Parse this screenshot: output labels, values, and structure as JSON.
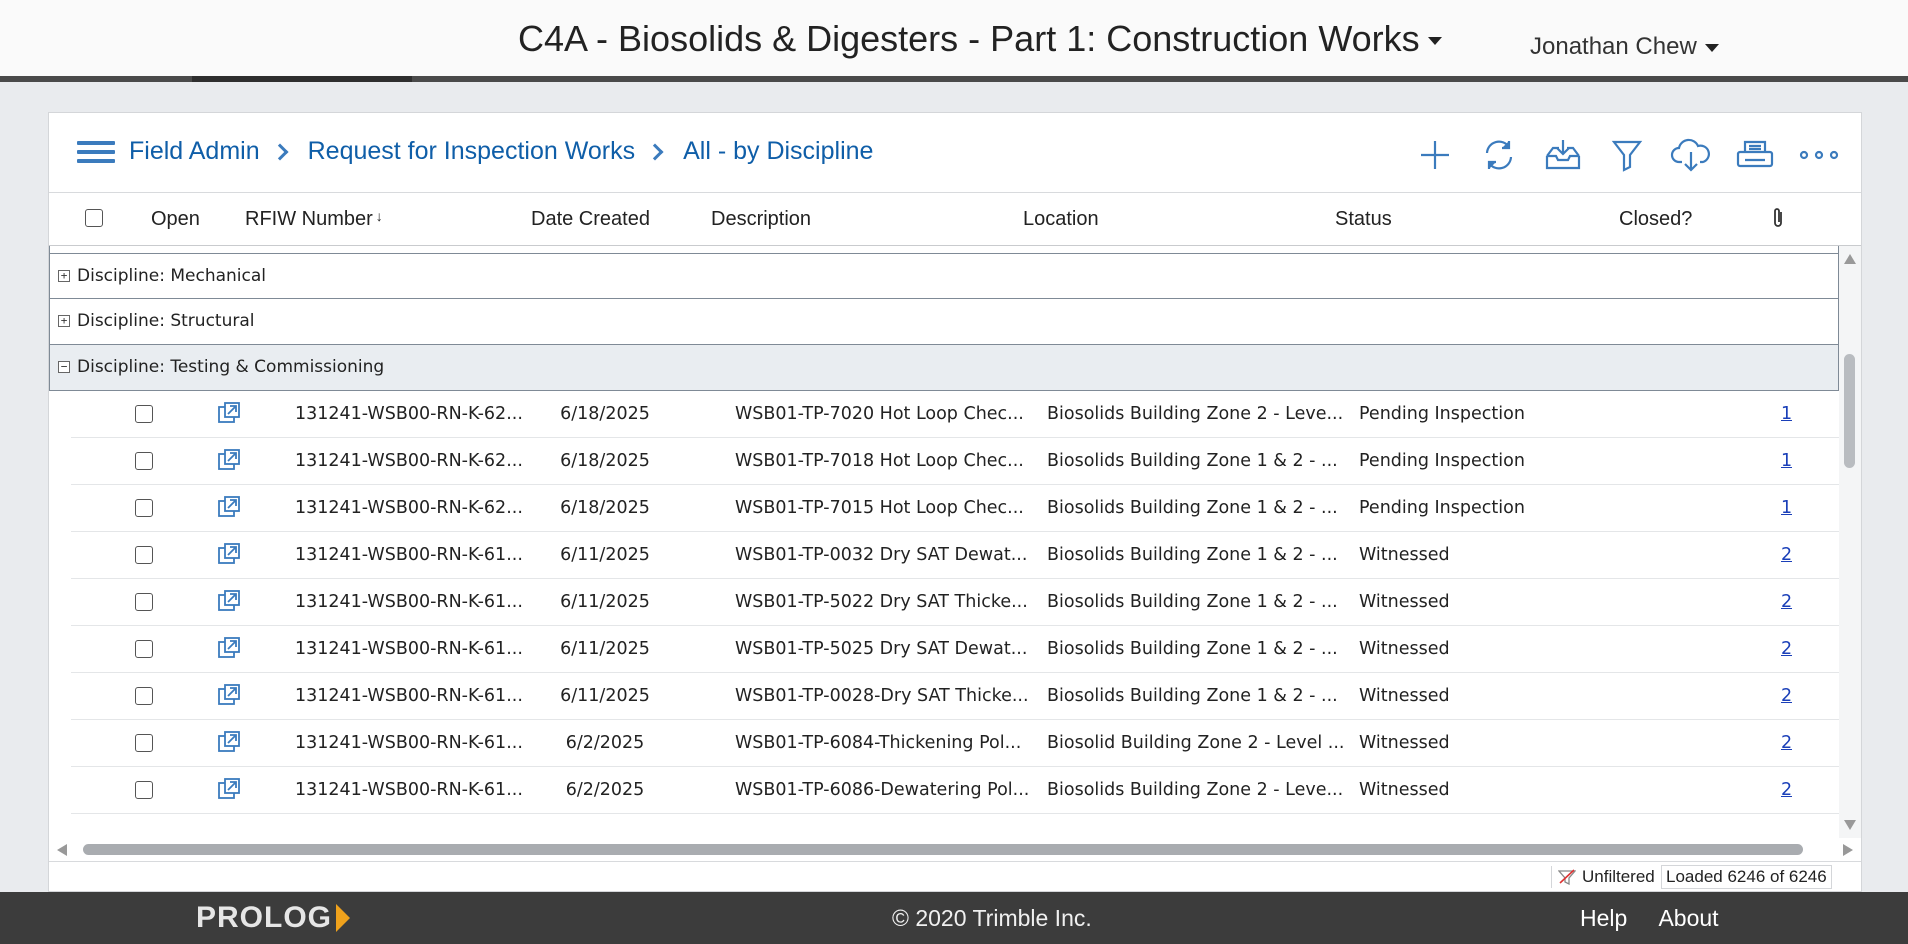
{
  "header": {
    "project_title": "C4A - Biosolids & Digesters - Part 1: Construction Works",
    "user_name": "Jonathan Chew"
  },
  "breadcrumb": [
    "Field Admin",
    "Request for Inspection Works",
    "All - by Discipline"
  ],
  "toolbar": {
    "icons": [
      "add-icon",
      "refresh-icon",
      "inbox-download-icon",
      "filter-icon",
      "cloud-download-icon",
      "print-icon",
      "more-icon"
    ]
  },
  "columns": {
    "open": "Open",
    "number": "RFIW Number",
    "sort_indicator": "↓",
    "date": "Date Created",
    "description": "Description",
    "location": "Location",
    "status": "Status",
    "closed": "Closed?"
  },
  "groups": {
    "mechanical": "Discipline: Mechanical",
    "structural": "Discipline: Structural",
    "testing": "Discipline: Testing & Commissioning"
  },
  "rows": [
    {
      "number": "131241-WSB00-RN-K-62...",
      "date": "6/18/2025",
      "description": "WSB01-TP-7020 Hot Loop Chec...",
      "location": "Biosolids Building Zone 2 - Leve...",
      "status": "Pending Inspection",
      "attachments": "1"
    },
    {
      "number": "131241-WSB00-RN-K-62...",
      "date": "6/18/2025",
      "description": "WSB01-TP-7018 Hot Loop Chec...",
      "location": "Biosolids Building Zone 1 & 2 - ...",
      "status": "Pending Inspection",
      "attachments": "1"
    },
    {
      "number": "131241-WSB00-RN-K-62...",
      "date": "6/18/2025",
      "description": "WSB01-TP-7015 Hot Loop Chec...",
      "location": "Biosolids Building Zone 1 & 2 - ...",
      "status": "Pending Inspection",
      "attachments": "1"
    },
    {
      "number": "131241-WSB00-RN-K-61...",
      "date": "6/11/2025",
      "description": "WSB01-TP-0032 Dry SAT Dewat...",
      "location": "Biosolids Building Zone 1 & 2 - ...",
      "status": "Witnessed",
      "attachments": "2"
    },
    {
      "number": "131241-WSB00-RN-K-61...",
      "date": "6/11/2025",
      "description": "WSB01-TP-5022 Dry SAT Thicke...",
      "location": "Biosolids Building Zone 1 & 2 - ...",
      "status": "Witnessed",
      "attachments": "2"
    },
    {
      "number": "131241-WSB00-RN-K-61...",
      "date": "6/11/2025",
      "description": "WSB01-TP-5025 Dry SAT Dewat...",
      "location": "Biosolids Building Zone 1 & 2 - ...",
      "status": "Witnessed",
      "attachments": "2"
    },
    {
      "number": "131241-WSB00-RN-K-61...",
      "date": "6/11/2025",
      "description": "WSB01-TP-0028-Dry SAT Thicke...",
      "location": "Biosolids Building Zone 1 & 2 - ...",
      "status": "Witnessed",
      "attachments": "2"
    },
    {
      "number": "131241-WSB00-RN-K-61...",
      "date": "6/2/2025",
      "description": "WSB01-TP-6084-Thickening Pol...",
      "location": "Biosolid Building Zone 2 - Level ...",
      "status": "Witnessed",
      "attachments": "2"
    },
    {
      "number": "131241-WSB00-RN-K-61...",
      "date": "6/2/2025",
      "description": "WSB01-TP-6086-Dewatering Pol...",
      "location": "Biosolids Building Zone 2 - Leve...",
      "status": "Witnessed",
      "attachments": "2"
    }
  ],
  "status_bar": {
    "filter_state": "Unfiltered",
    "loaded_text": "Loaded 6246 of 6246"
  },
  "footer": {
    "logo": "PROLOG",
    "copyright": "© 2020 Trimble Inc.",
    "help": "Help",
    "about": "About"
  },
  "colors": {
    "accent": "#3b7bbd",
    "link": "#0f5ea8",
    "footer_bg": "#3c3c3c",
    "logo_accent": "#f0a21c"
  }
}
